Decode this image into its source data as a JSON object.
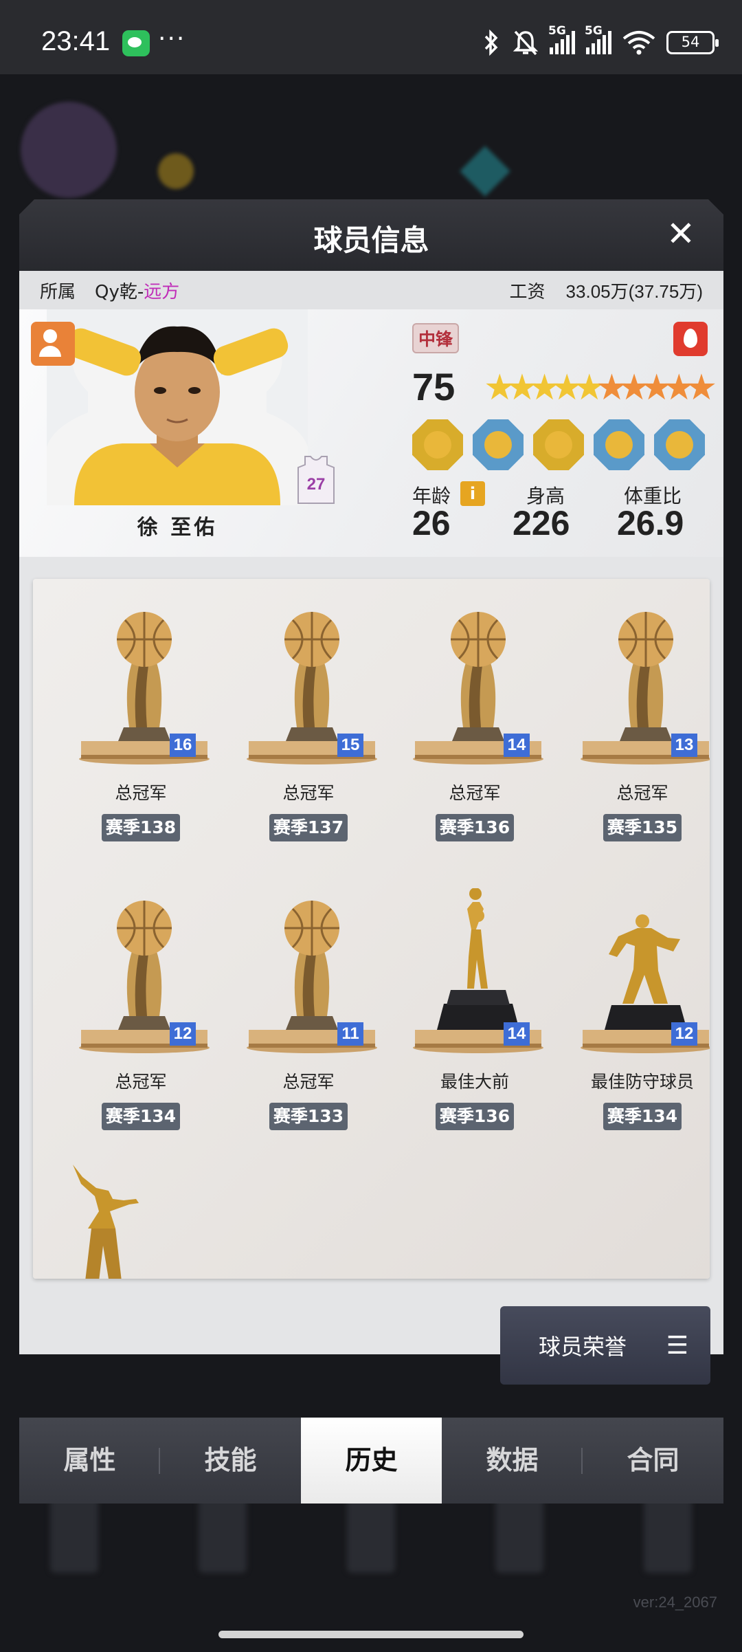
{
  "status_bar": {
    "time": "23:41",
    "dots": "···",
    "network_1": "5G",
    "network_2": "5G",
    "battery": "54"
  },
  "modal": {
    "title": "球员信息",
    "close_label": "✕"
  },
  "team_row": {
    "team_label": "所属",
    "team_name": "Qy乾-",
    "team_accent": "远方",
    "salary_label": "工资",
    "salary_value": "33.05万(37.75万)"
  },
  "player": {
    "name": "徐 至佑",
    "jersey_number": "27",
    "position": "中锋",
    "rating": "75",
    "stars": {
      "total": 10,
      "gold": 5,
      "orange": 5
    },
    "stats": [
      {
        "label": "年龄",
        "value": "26"
      },
      {
        "label": "身高",
        "value": "226"
      },
      {
        "label": "体重比",
        "value": "26.9"
      }
    ],
    "info_icon": "i",
    "skill_badges": [
      "gold",
      "blue",
      "gold",
      "blue",
      "blue"
    ]
  },
  "trophies": [
    {
      "name": "总冠军",
      "season": "赛季138",
      "count": "16",
      "type": "ball"
    },
    {
      "name": "总冠军",
      "season": "赛季137",
      "count": "15",
      "type": "ball"
    },
    {
      "name": "总冠军",
      "season": "赛季136",
      "count": "14",
      "type": "ball"
    },
    {
      "name": "总冠军",
      "season": "赛季135",
      "count": "13",
      "type": "ball"
    },
    {
      "name": "总冠军",
      "season": "赛季134",
      "count": "12",
      "type": "ball"
    },
    {
      "name": "总冠军",
      "season": "赛季133",
      "count": "11",
      "type": "ball"
    },
    {
      "name": "最佳大前",
      "season": "赛季136",
      "count": "14",
      "type": "shooter"
    },
    {
      "name": "最佳防守球员",
      "season": "赛季134",
      "count": "12",
      "type": "defender"
    }
  ],
  "honors_button": {
    "label": "球员荣誉",
    "icon": "☰"
  },
  "tabs": [
    {
      "label": "属性"
    },
    {
      "label": "技能"
    },
    {
      "label": "历史",
      "active": true
    },
    {
      "label": "数据"
    },
    {
      "label": "合同"
    }
  ],
  "version": "ver:24_2067",
  "colors": {
    "accent_purple": "#c02cb8",
    "badge_blue": "#3e6dd6",
    "season_tag": "#5c6470"
  }
}
